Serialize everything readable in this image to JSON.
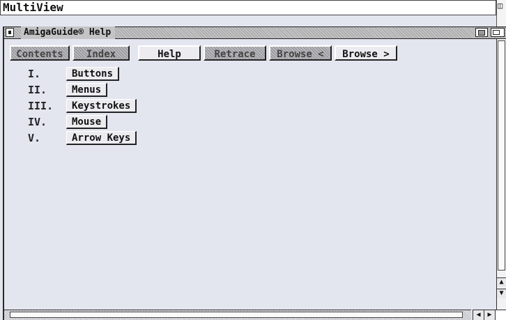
{
  "screen": {
    "title": "MultiView"
  },
  "window": {
    "title": "AmigaGuide® Help"
  },
  "toolbar": {
    "buttons": [
      {
        "label": "Contents",
        "disabled": true
      },
      {
        "label": "Index",
        "disabled": true
      },
      {
        "label": "Help",
        "disabled": false
      },
      {
        "label": "Retrace",
        "disabled": true
      },
      {
        "label": "Browse <",
        "disabled": true
      },
      {
        "label": "Browse >",
        "disabled": false
      }
    ]
  },
  "toc": {
    "items": [
      {
        "numeral": "I.",
        "label": "Buttons"
      },
      {
        "numeral": "II.",
        "label": "Menus"
      },
      {
        "numeral": "III.",
        "label": "Keystrokes"
      },
      {
        "numeral": "IV.",
        "label": "Mouse"
      },
      {
        "numeral": "V.",
        "label": "Arrow Keys"
      }
    ]
  },
  "colors": {
    "background": "#e3e5ef",
    "button_face": "#ececf0",
    "disabled_pattern": "#b9b9bd"
  }
}
